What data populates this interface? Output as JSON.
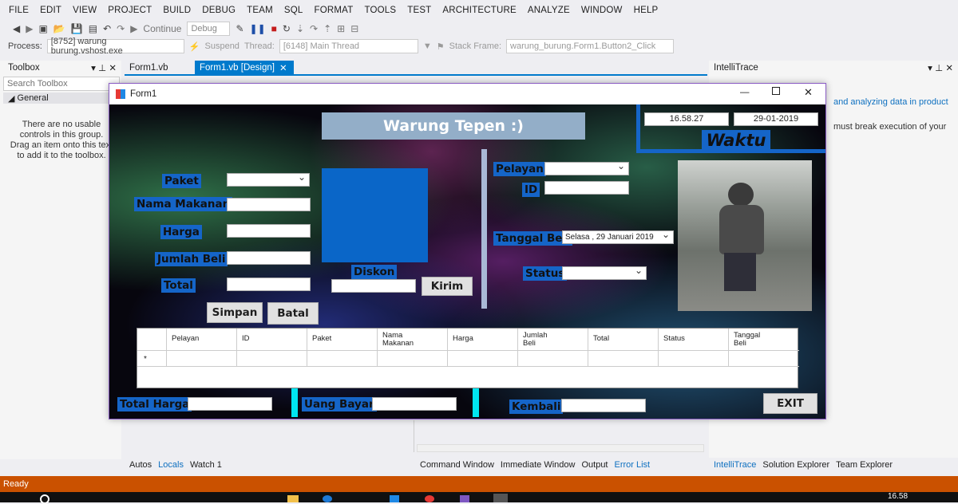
{
  "menu": [
    "FILE",
    "EDIT",
    "VIEW",
    "PROJECT",
    "BUILD",
    "DEBUG",
    "TEAM",
    "SQL",
    "FORMAT",
    "TOOLS",
    "TEST",
    "ARCHITECTURE",
    "ANALYZE",
    "WINDOW",
    "HELP"
  ],
  "toolbar": {
    "continue": "Continue",
    "config": "Debug"
  },
  "debugbar": {
    "process_label": "Process:",
    "process": "[8752] warung burung.vshost.exe",
    "suspend": "Suspend",
    "thread_label": "Thread:",
    "thread": "[6148] Main Thread",
    "stack_label": "Stack Frame:",
    "stack": "warung_burung.Form1.Button2_Click"
  },
  "toolbox": {
    "title": "Toolbox",
    "search": "Search Toolbox",
    "group": "General",
    "hint": "There are no usable controls in this group. Drag an item onto this text to add it to the toolbox."
  },
  "tabs": {
    "t1": "Form1.vb",
    "t2": "Form1.vb [Design]"
  },
  "intellitrace": {
    "title": "IntelliTrace",
    "line1": "and analyzing data in product",
    "line2": "must break execution of your"
  },
  "form": {
    "title": "Form1",
    "heading": "Warung Tepen :)",
    "time": "16.58.27",
    "date": "29-01-2019",
    "waktu": "Waktu",
    "paket": "Paket",
    "nama": "Nama Makanan",
    "harga": "Harga",
    "jumlah": "Jumlah Beli",
    "total": "Total",
    "simpan": "Simpan",
    "batal": "Batal",
    "diskon": "Diskon",
    "kirim": "Kirim",
    "pelayan": "Pelayan",
    "id": "ID",
    "tanggal": "Tanggal Beli",
    "tanggal_val": "Selasa , 29   Januari   2019",
    "status": "Status",
    "grid_cols": [
      "Pelayan",
      "ID",
      "Paket",
      "Nama Makanan",
      "Harga",
      "Jumlah Beli",
      "Total",
      "Status",
      "Tanggal Beli"
    ],
    "total_harga": "Total Harga",
    "uang_bayar": "Uang Bayar",
    "kembali": "Kembali",
    "exit": "EXIT"
  },
  "bottom": {
    "autos": "Autos",
    "locals": "Locals",
    "watch": "Watch 1",
    "cmd": "Command Window",
    "imm": "Immediate Window",
    "output": "Output",
    "errors": "Error List",
    "it": "IntelliTrace",
    "se": "Solution Explorer",
    "te": "Team Explorer"
  },
  "status": "Ready",
  "clock": "16.58"
}
